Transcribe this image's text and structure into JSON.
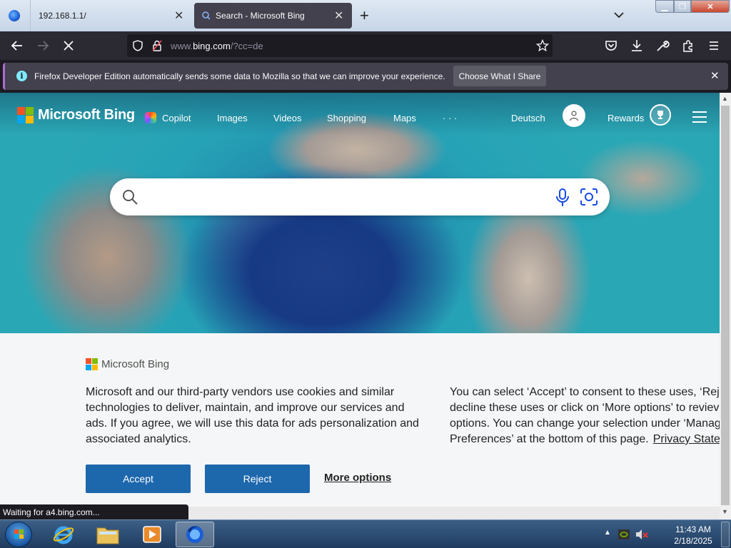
{
  "browser": {
    "tabs": [
      {
        "title": "192.168.1.1/"
      },
      {
        "title": "Search - Microsoft Bing"
      }
    ],
    "url_prefix": "www.",
    "url_host": "bing.com",
    "url_path": "/?cc=de",
    "status": "Waiting for a4.bing.com..."
  },
  "infobar": {
    "message": "Firefox Developer Edition automatically sends some data to Mozilla so that we can improve your experience.",
    "button": "Choose What I Share"
  },
  "bing": {
    "logo_text": "Microsoft Bing",
    "nav": [
      "Copilot",
      "Images",
      "Videos",
      "Shopping",
      "Maps",
      "· · ·"
    ],
    "language": "Deutsch",
    "rewards": "Rewards",
    "search_placeholder": ""
  },
  "consent": {
    "logo_text": "Microsoft Bing",
    "left_text": "Microsoft and our third-party vendors use cookies and similar technologies to deliver, maintain, and improve our services and ads. If you agree, we will use this data for ads personalization and associated analytics.",
    "right_lines": [
      "You can select ‘Accept’ to consent to these uses, ‘Rej",
      "decline these uses or click on ‘More options’ to reviev",
      "options. You can change your selection under ‘Manag",
      "Preferences’ at the bottom of this page."
    ],
    "privacy_link": "Privacy State",
    "accept": "Accept",
    "reject": "Reject",
    "more_options": "More options"
  },
  "taskbar": {
    "time": "11:43 AM",
    "date": "2/18/2025"
  },
  "colors": {
    "accent_button": "#1d67ad",
    "ms_red": "#f35325",
    "ms_green": "#81bc06",
    "ms_blue": "#05a6f0",
    "ms_yellow": "#ffba08"
  }
}
